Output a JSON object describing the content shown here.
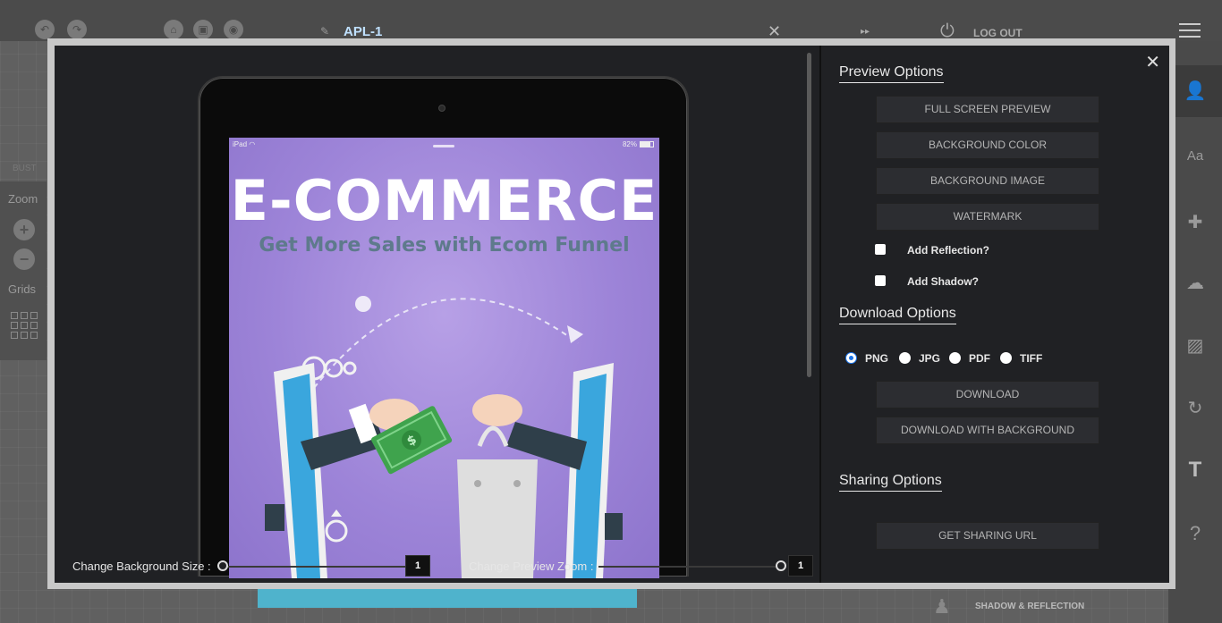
{
  "app": {
    "project_name": "APL-1",
    "logout_label": "LOG OUT",
    "left_panel": {
      "faded_label": "BUST",
      "zoom_label": "Zoom",
      "zoom_in": "+",
      "zoom_out": "−",
      "grids_label": "Grids"
    },
    "bottom_bar": {
      "shadow_reflection_label": "SHADOW & REFLECTION"
    }
  },
  "preview": {
    "status_left": "iPad",
    "status_right": "82%",
    "screen_title": "E-COMMERCE",
    "screen_subtitle": "Get More Sales with Ecom Funnel",
    "background_size": {
      "label": "Change Background Size :",
      "value": "1",
      "fraction": 0
    },
    "preview_zoom": {
      "label": "Change Preview Zoom :",
      "value": "1",
      "fraction": 1
    }
  },
  "options": {
    "preview": {
      "title": "Preview Options",
      "full_screen": "FULL SCREEN PREVIEW",
      "background_color": "BACKGROUND COLOR",
      "background_image": "BACKGROUND IMAGE",
      "watermark": "WATERMARK",
      "add_reflection": "Add Reflection?",
      "add_shadow": "Add Shadow?"
    },
    "download": {
      "title": "Download Options",
      "formats": [
        "PNG",
        "JPG",
        "PDF",
        "TIFF"
      ],
      "selected_format": "PNG",
      "download": "DOWNLOAD",
      "download_with_background": "DOWNLOAD WITH BACKGROUND"
    },
    "sharing": {
      "title": "Sharing Options",
      "get_url": "GET SHARING URL"
    }
  },
  "colors": {
    "accent": "#1a73e8",
    "modal_bg": "#202124",
    "button_bg": "#2c2d31",
    "screen_purple": "#9d84d8",
    "teal": "#4fb3cc"
  }
}
